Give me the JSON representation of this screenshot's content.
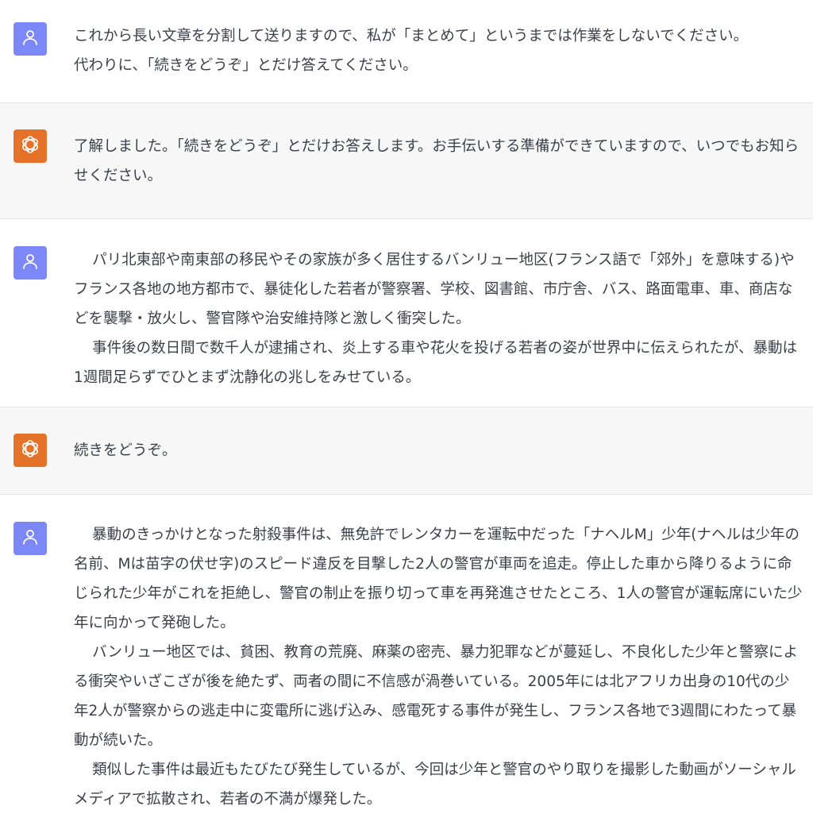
{
  "conversation": {
    "messages": [
      {
        "role": "user",
        "avatar_icon": "user-icon",
        "paragraphs": [
          "これから長い文章を分割して送りますので、私が「まとめて」というまでは作業をしないでください。",
          "代わりに、「続きをどうぞ」とだけ答えてください。"
        ]
      },
      {
        "role": "assistant",
        "avatar_icon": "openai-logo-icon",
        "paragraphs": [
          "了解しました。「続きをどうぞ」とだけお答えします。お手伝いする準備ができていますので、いつでもお知らせください。"
        ]
      },
      {
        "role": "user",
        "avatar_icon": "user-icon",
        "paragraphs": [
          "パリ北東部や南東部の移民やその家族が多く居住するバンリュー地区(フランス語で「郊外」を意味する)やフランス各地の地方都市で、暴徒化した若者が警察署、学校、図書館、市庁舎、バス、路面電車、車、商店などを襲撃・放火し、警官隊や治安維持隊と激しく衝突した。",
          "事件後の数日間で数千人が逮捕され、炎上する車や花火を投げる若者の姿が世界中に伝えられたが、暴動は1週間足らずでひとまず沈静化の兆しをみせている。"
        ]
      },
      {
        "role": "assistant",
        "avatar_icon": "openai-logo-icon",
        "paragraphs": [
          "続きをどうぞ。"
        ]
      },
      {
        "role": "user",
        "avatar_icon": "user-icon",
        "paragraphs": [
          "暴動のきっかけとなった射殺事件は、無免許でレンタカーを運転中だった「ナヘルM」少年(ナヘルは少年の名前、Mは苗字の伏せ字)のスピード違反を目撃した2人の警官が車両を追走。停止した車から降りるように命じられた少年がこれを拒絶し、警官の制止を振り切って車を再発進させたところ、1人の警官が運転席にいた少年に向かって発砲した。",
          "バンリュー地区では、貧困、教育の荒廃、麻薬の密売、暴力犯罪などが蔓延し、不良化した少年と警察による衝突やいざこざが後を絶たず、両者の間に不信感が渦巻いている。2005年には北アフリカ出身の10代の少年2人が警察からの逃走中に変電所に逃げ込み、感電死する事件が発生し、フランス各地で3週間にわたって暴動が続いた。",
          "類似した事件は最近もたびたび発生しているが、今回は少年と警官のやり取りを撮影した動画がソーシャルメディアで拡散され、若者の不満が爆発した。"
        ]
      }
    ]
  }
}
